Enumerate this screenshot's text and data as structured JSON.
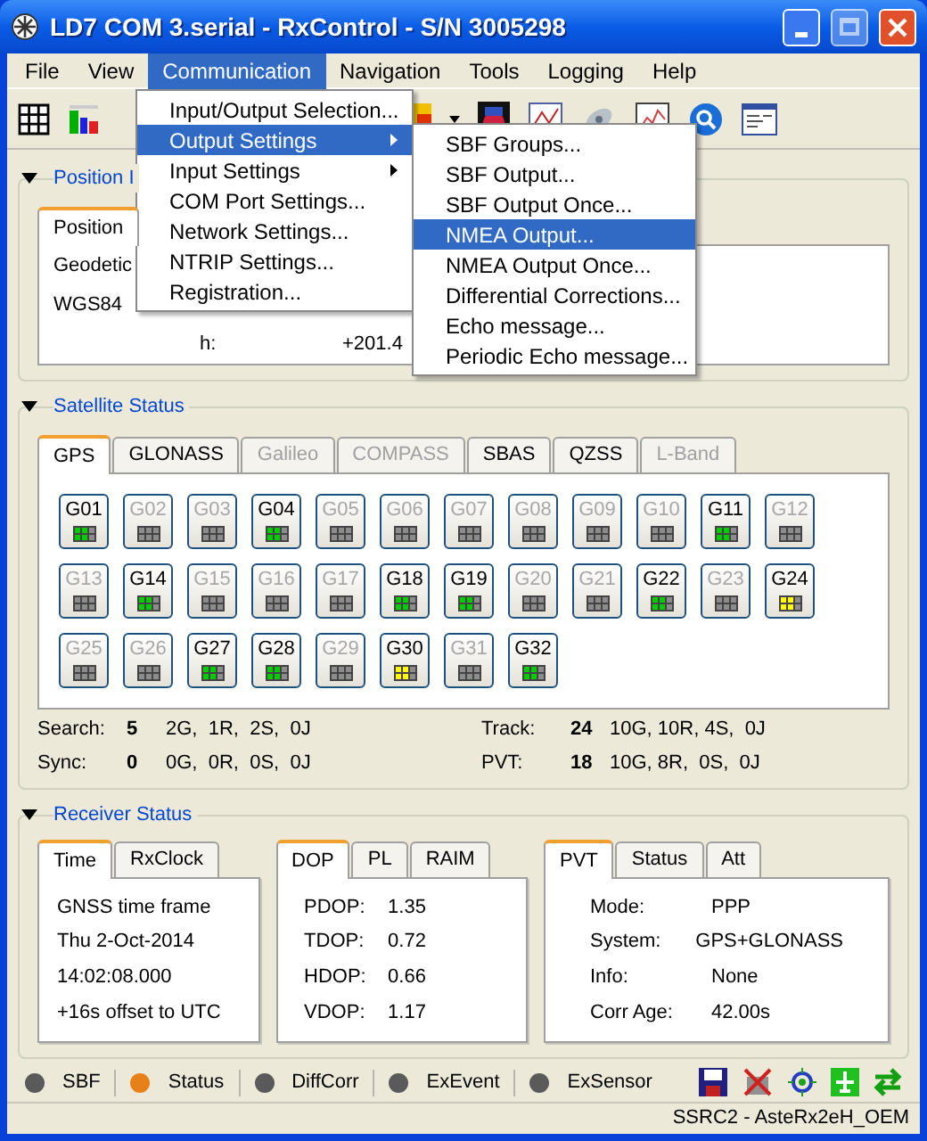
{
  "window": {
    "title": "LD7 COM 3.serial - RxControl - S/N 3005298"
  },
  "menu_bar": [
    {
      "label": "File",
      "selected": false
    },
    {
      "label": "View",
      "selected": false
    },
    {
      "label": "Communication",
      "selected": true
    },
    {
      "label": "Navigation",
      "selected": false
    },
    {
      "label": "Tools",
      "selected": false
    },
    {
      "label": "Logging",
      "selected": false
    },
    {
      "label": "Help",
      "selected": false
    }
  ],
  "communication_menu": [
    {
      "label": "Input/Output Selection...",
      "selected": false,
      "submenu": false
    },
    {
      "label": "Output Settings",
      "selected": true,
      "submenu": true
    },
    {
      "label": "Input Settings",
      "selected": false,
      "submenu": true
    },
    {
      "label": "COM Port Settings...",
      "selected": false,
      "submenu": false
    },
    {
      "label": "Network Settings...",
      "selected": false,
      "submenu": false
    },
    {
      "label": "NTRIP Settings...",
      "selected": false,
      "submenu": false
    },
    {
      "label": "Registration...",
      "selected": false,
      "submenu": false
    }
  ],
  "output_settings_menu": [
    {
      "label": "SBF Groups...",
      "selected": false
    },
    {
      "label": "SBF Output...",
      "selected": false
    },
    {
      "label": "SBF Output Once...",
      "selected": false
    },
    {
      "label": "NMEA Output...",
      "selected": true
    },
    {
      "label": "NMEA Output Once...",
      "selected": false
    },
    {
      "label": "Differential Corrections...",
      "selected": false
    },
    {
      "label": "Echo message...",
      "selected": false
    },
    {
      "label": "Periodic Echo message...",
      "selected": false
    }
  ],
  "position_info": {
    "title": "Position I",
    "tab": "Position",
    "lines": [
      "Geodetic",
      "WGS84"
    ],
    "label": "h:",
    "value": "+201.4"
  },
  "satellite_status": {
    "title": "Satellite Status",
    "tabs": [
      {
        "label": "GPS",
        "selected": true,
        "disabled": false
      },
      {
        "label": "GLONASS",
        "selected": false,
        "disabled": false
      },
      {
        "label": "Galileo",
        "selected": false,
        "disabled": true
      },
      {
        "label": "COMPASS",
        "selected": false,
        "disabled": true
      },
      {
        "label": "SBAS",
        "selected": false,
        "disabled": false
      },
      {
        "label": "QZSS",
        "selected": false,
        "disabled": false
      },
      {
        "label": "L-Band",
        "selected": false,
        "disabled": true
      }
    ],
    "satellites": [
      {
        "label": "G01",
        "tracked": true,
        "color": "#00cc00"
      },
      {
        "label": "G02",
        "tracked": false,
        "color": "#8c8c8c"
      },
      {
        "label": "G03",
        "tracked": false,
        "color": "#8c8c8c"
      },
      {
        "label": "G04",
        "tracked": true,
        "color": "#00cc00"
      },
      {
        "label": "G05",
        "tracked": false,
        "color": "#8c8c8c"
      },
      {
        "label": "G06",
        "tracked": false,
        "color": "#8c8c8c"
      },
      {
        "label": "G07",
        "tracked": false,
        "color": "#8c8c8c"
      },
      {
        "label": "G08",
        "tracked": false,
        "color": "#8c8c8c"
      },
      {
        "label": "G09",
        "tracked": false,
        "color": "#8c8c8c"
      },
      {
        "label": "G10",
        "tracked": false,
        "color": "#8c8c8c"
      },
      {
        "label": "G11",
        "tracked": true,
        "color": "#00cc00"
      },
      {
        "label": "G12",
        "tracked": false,
        "color": "#8c8c8c"
      },
      {
        "label": "G13",
        "tracked": false,
        "color": "#8c8c8c"
      },
      {
        "label": "G14",
        "tracked": true,
        "color": "#00cc00"
      },
      {
        "label": "G15",
        "tracked": false,
        "color": "#8c8c8c"
      },
      {
        "label": "G16",
        "tracked": false,
        "color": "#8c8c8c"
      },
      {
        "label": "G17",
        "tracked": false,
        "color": "#8c8c8c"
      },
      {
        "label": "G18",
        "tracked": true,
        "color": "#00cc00"
      },
      {
        "label": "G19",
        "tracked": true,
        "color": "#00cc00"
      },
      {
        "label": "G20",
        "tracked": false,
        "color": "#8c8c8c"
      },
      {
        "label": "G21",
        "tracked": false,
        "color": "#8c8c8c"
      },
      {
        "label": "G22",
        "tracked": true,
        "color": "#00cc00"
      },
      {
        "label": "G23",
        "tracked": false,
        "color": "#8c8c8c"
      },
      {
        "label": "G24",
        "tracked": true,
        "color": "#ffff00"
      },
      {
        "label": "G25",
        "tracked": false,
        "color": "#8c8c8c"
      },
      {
        "label": "G26",
        "tracked": false,
        "color": "#8c8c8c"
      },
      {
        "label": "G27",
        "tracked": true,
        "color": "#00cc00"
      },
      {
        "label": "G28",
        "tracked": true,
        "color": "#00cc00"
      },
      {
        "label": "G29",
        "tracked": false,
        "color": "#8c8c8c"
      },
      {
        "label": "G30",
        "tracked": true,
        "color": "#ffff00"
      },
      {
        "label": "G31",
        "tracked": false,
        "color": "#8c8c8c"
      },
      {
        "label": "G32",
        "tracked": true,
        "color": "#00cc00"
      }
    ],
    "counts": [
      {
        "label": "Search:",
        "total": "5",
        "detail": "2G,  1R,  2S,  0J"
      },
      {
        "label": "Track:",
        "total": "24",
        "detail": "10G, 10R, 4S,  0J"
      },
      {
        "label": "Sync:",
        "total": "0",
        "detail": "0G,  0R,  0S,  0J"
      },
      {
        "label": "PVT:",
        "total": "18",
        "detail": "10G, 8R,  0S,  0J"
      }
    ]
  },
  "receiver_status": {
    "title": "Receiver Status",
    "time_panel": {
      "tabs": [
        {
          "label": "Time",
          "selected": true
        },
        {
          "label": "RxClock",
          "selected": false
        }
      ],
      "lines": [
        "GNSS time frame",
        "Thu 2-Oct-2014",
        "14:02:08.000",
        "+16s offset to UTC"
      ]
    },
    "dop_panel": {
      "tabs": [
        {
          "label": "DOP",
          "selected": true
        },
        {
          "label": "PL",
          "selected": false
        },
        {
          "label": "RAIM",
          "selected": false
        }
      ],
      "rows": [
        {
          "label": "PDOP:",
          "value": "1.35"
        },
        {
          "label": "TDOP:",
          "value": "0.72"
        },
        {
          "label": "HDOP:",
          "value": "0.66"
        },
        {
          "label": "VDOP:",
          "value": "1.17"
        }
      ]
    },
    "pvt_panel": {
      "tabs": [
        {
          "label": "PVT",
          "selected": true
        },
        {
          "label": "Status",
          "selected": false
        },
        {
          "label": "Att",
          "selected": false
        }
      ],
      "rows": [
        {
          "label": "Mode:",
          "value": "PPP"
        },
        {
          "label": "System:",
          "value": "GPS+GLONASS"
        },
        {
          "label": "Info:",
          "value": "None"
        },
        {
          "label": "Corr Age:",
          "value": "42.00s"
        }
      ]
    }
  },
  "indicators": [
    {
      "label": "SBF",
      "color": "#5a5a5a"
    },
    {
      "label": "Status",
      "color": "#e8801a"
    },
    {
      "label": "DiffCorr",
      "color": "#5a5a5a"
    },
    {
      "label": "ExEvent",
      "color": "#5a5a5a"
    },
    {
      "label": "ExSensor",
      "color": "#5a5a5a"
    }
  ],
  "status_bar": {
    "text": "SSRC2 - AsteRx2eH_OEM"
  }
}
